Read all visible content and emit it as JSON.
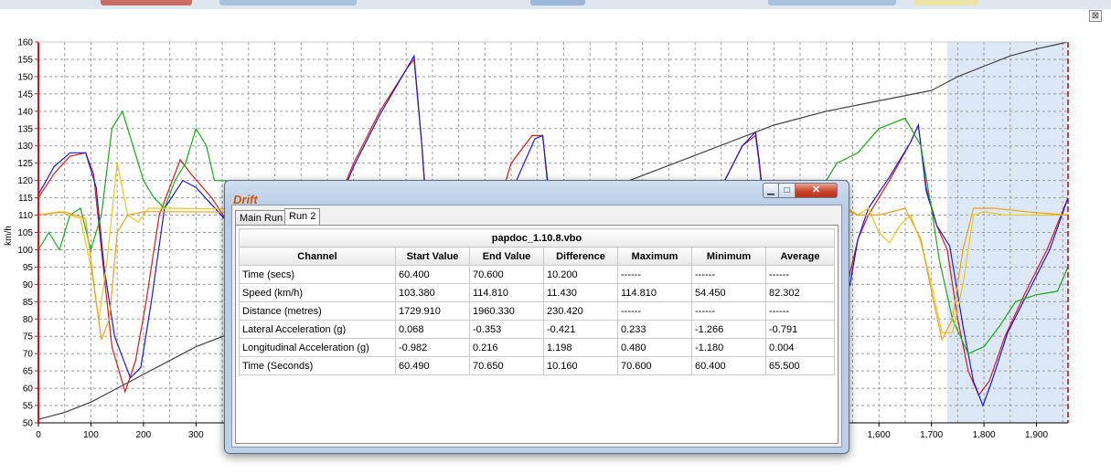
{
  "chart_data": {
    "type": "line",
    "ylabel": "km/h",
    "xlim": [
      0,
      1960
    ],
    "ylim": [
      50,
      160
    ],
    "x_ticks": [
      0,
      100,
      200,
      300,
      1600,
      1700,
      1800,
      1900
    ],
    "x_tick_labels": [
      "0",
      "100",
      "200",
      "300",
      "1,600",
      "1,700",
      "1,800",
      "1,900"
    ],
    "y_ticks": [
      50,
      55,
      60,
      65,
      70,
      75,
      80,
      85,
      90,
      95,
      100,
      105,
      110,
      115,
      120,
      125,
      130,
      135,
      140,
      145,
      150,
      155,
      160
    ],
    "grid": true,
    "highlight_range": [
      1730,
      1960
    ],
    "series": [
      {
        "color": "#d81b1b",
        "points": [
          [
            0,
            115
          ],
          [
            30,
            122
          ],
          [
            60,
            127
          ],
          [
            90,
            128
          ],
          [
            105,
            122
          ],
          [
            120,
            100
          ],
          [
            140,
            72
          ],
          [
            165,
            59
          ],
          [
            185,
            68
          ],
          [
            205,
            85
          ],
          [
            230,
            110
          ],
          [
            270,
            126
          ],
          [
            290,
            122
          ],
          [
            330,
            115
          ],
          [
            360,
            108
          ],
          [
            380,
            98
          ],
          [
            540,
            103
          ],
          [
            600,
            125
          ],
          [
            650,
            140
          ],
          [
            700,
            152
          ],
          [
            715,
            155
          ],
          [
            730,
            130
          ],
          [
            740,
            110
          ],
          [
            880,
            115
          ],
          [
            900,
            125
          ],
          [
            940,
            133
          ],
          [
            960,
            133
          ],
          [
            975,
            110
          ],
          [
            995,
            102
          ],
          [
            1020,
            100
          ],
          [
            1040,
            80
          ],
          [
            1060,
            70
          ],
          [
            1080,
            58
          ],
          [
            1100,
            57
          ],
          [
            1130,
            75
          ],
          [
            1160,
            95
          ],
          [
            1170,
            103
          ],
          [
            1220,
            108
          ],
          [
            1260,
            108
          ],
          [
            1300,
            118
          ],
          [
            1340,
            130
          ],
          [
            1365,
            133
          ],
          [
            1372,
            125
          ],
          [
            1382,
            110
          ],
          [
            1400,
            102
          ],
          [
            1420,
            100
          ],
          [
            1440,
            80
          ],
          [
            1460,
            62
          ],
          [
            1480,
            60
          ],
          [
            1500,
            75
          ],
          [
            1540,
            90
          ],
          [
            1560,
            103
          ],
          [
            1580,
            110
          ],
          [
            1620,
            120
          ],
          [
            1660,
            131
          ],
          [
            1675,
            136
          ],
          [
            1690,
            118
          ],
          [
            1710,
            107
          ],
          [
            1730,
            100
          ],
          [
            1750,
            80
          ],
          [
            1770,
            65
          ],
          [
            1790,
            58
          ],
          [
            1810,
            62
          ],
          [
            1840,
            75
          ],
          [
            1880,
            88
          ],
          [
            1920,
            100
          ],
          [
            1960,
            115
          ]
        ]
      },
      {
        "color": "#1a1ad8",
        "points": [
          [
            0,
            116
          ],
          [
            30,
            124
          ],
          [
            60,
            128
          ],
          [
            90,
            128
          ],
          [
            110,
            118
          ],
          [
            125,
            95
          ],
          [
            145,
            75
          ],
          [
            175,
            63
          ],
          [
            195,
            66
          ],
          [
            215,
            85
          ],
          [
            240,
            112
          ],
          [
            275,
            120
          ],
          [
            300,
            118
          ],
          [
            330,
            113
          ],
          [
            360,
            108
          ],
          [
            380,
            97
          ],
          [
            540,
            102
          ],
          [
            600,
            124
          ],
          [
            650,
            139
          ],
          [
            700,
            152
          ],
          [
            715,
            156
          ],
          [
            730,
            130
          ],
          [
            740,
            108
          ],
          [
            880,
            113
          ],
          [
            910,
            120
          ],
          [
            945,
            132
          ],
          [
            960,
            133
          ],
          [
            975,
            112
          ],
          [
            995,
            103
          ],
          [
            1020,
            101
          ],
          [
            1045,
            82
          ],
          [
            1065,
            72
          ],
          [
            1085,
            60
          ],
          [
            1105,
            57
          ],
          [
            1135,
            75
          ],
          [
            1160,
            94
          ],
          [
            1170,
            104
          ],
          [
            1220,
            108
          ],
          [
            1260,
            108
          ],
          [
            1300,
            118
          ],
          [
            1340,
            130
          ],
          [
            1365,
            134
          ],
          [
            1372,
            126
          ],
          [
            1382,
            111
          ],
          [
            1400,
            104
          ],
          [
            1420,
            101
          ],
          [
            1445,
            82
          ],
          [
            1465,
            64
          ],
          [
            1485,
            60
          ],
          [
            1505,
            75
          ],
          [
            1545,
            90
          ],
          [
            1560,
            103
          ],
          [
            1580,
            112
          ],
          [
            1620,
            121
          ],
          [
            1660,
            131
          ],
          [
            1675,
            136
          ],
          [
            1690,
            117
          ],
          [
            1710,
            107
          ],
          [
            1735,
            101
          ],
          [
            1760,
            78
          ],
          [
            1780,
            62
          ],
          [
            1798,
            55
          ],
          [
            1815,
            62
          ],
          [
            1845,
            76
          ],
          [
            1885,
            88
          ],
          [
            1925,
            100
          ],
          [
            1960,
            115
          ]
        ]
      },
      {
        "color": "#1aa81a",
        "points": [
          [
            0,
            100
          ],
          [
            20,
            105
          ],
          [
            40,
            100
          ],
          [
            60,
            110
          ],
          [
            80,
            112
          ],
          [
            100,
            100
          ],
          [
            120,
            110
          ],
          [
            140,
            135
          ],
          [
            160,
            140
          ],
          [
            180,
            130
          ],
          [
            200,
            120
          ],
          [
            220,
            115
          ],
          [
            240,
            112
          ],
          [
            260,
            120
          ],
          [
            280,
            125
          ],
          [
            300,
            135
          ],
          [
            320,
            130
          ],
          [
            335,
            120
          ],
          [
            1450,
            115
          ],
          [
            1480,
            110
          ],
          [
            1500,
            120
          ],
          [
            1520,
            125
          ],
          [
            1560,
            128
          ],
          [
            1600,
            135
          ],
          [
            1650,
            138
          ],
          [
            1680,
            130
          ],
          [
            1700,
            112
          ],
          [
            1715,
            97
          ],
          [
            1740,
            80
          ],
          [
            1770,
            70
          ],
          [
            1800,
            72
          ],
          [
            1830,
            78
          ],
          [
            1860,
            85
          ],
          [
            1900,
            87
          ],
          [
            1940,
            88
          ],
          [
            1960,
            95
          ]
        ]
      },
      {
        "color": "#e8c81c",
        "points": [
          [
            0,
            110
          ],
          [
            40,
            111
          ],
          [
            60,
            110
          ],
          [
            80,
            109
          ],
          [
            100,
            95
          ],
          [
            115,
            80
          ],
          [
            130,
            96
          ],
          [
            150,
            125
          ],
          [
            170,
            110
          ],
          [
            190,
            108
          ],
          [
            210,
            112
          ],
          [
            240,
            112
          ],
          [
            1450,
            110
          ],
          [
            1480,
            100
          ],
          [
            1500,
            115
          ],
          [
            1520,
            108
          ],
          [
            1540,
            112
          ],
          [
            1560,
            110
          ],
          [
            1580,
            112
          ],
          [
            1600,
            105
          ],
          [
            1620,
            102
          ],
          [
            1640,
            107
          ],
          [
            1660,
            110
          ],
          [
            1680,
            102
          ],
          [
            1700,
            90
          ],
          [
            1720,
            76
          ],
          [
            1740,
            76
          ],
          [
            1760,
            90
          ],
          [
            1780,
            110
          ],
          [
            1800,
            111
          ],
          [
            1840,
            110
          ],
          [
            1900,
            110
          ],
          [
            1960,
            110
          ]
        ]
      },
      {
        "color": "#f0a020",
        "points": [
          [
            0,
            110
          ],
          [
            50,
            111
          ],
          [
            90,
            109
          ],
          [
            110,
            85
          ],
          [
            120,
            74
          ],
          [
            135,
            80
          ],
          [
            150,
            105
          ],
          [
            170,
            110
          ],
          [
            200,
            111
          ],
          [
            240,
            111
          ],
          [
            1450,
            110
          ],
          [
            1470,
            100
          ],
          [
            1490,
            95
          ],
          [
            1510,
            100
          ],
          [
            1530,
            112
          ],
          [
            1560,
            110
          ],
          [
            1600,
            110
          ],
          [
            1650,
            112
          ],
          [
            1680,
            103
          ],
          [
            1700,
            88
          ],
          [
            1720,
            74
          ],
          [
            1740,
            80
          ],
          [
            1760,
            100
          ],
          [
            1780,
            112
          ],
          [
            1820,
            112
          ],
          [
            1880,
            111
          ],
          [
            1960,
            110
          ]
        ]
      },
      {
        "color": "#404040",
        "points": [
          [
            0,
            51
          ],
          [
            50,
            53
          ],
          [
            100,
            56
          ],
          [
            150,
            60
          ],
          [
            200,
            64
          ],
          [
            250,
            68
          ],
          [
            300,
            72
          ],
          [
            1400,
            136
          ],
          [
            1500,
            140
          ],
          [
            1600,
            143
          ],
          [
            1700,
            146
          ],
          [
            1750,
            150
          ],
          [
            1800,
            153
          ],
          [
            1850,
            156
          ],
          [
            1900,
            158
          ],
          [
            1960,
            160
          ]
        ]
      }
    ]
  },
  "dialog": {
    "tabs": [
      "Main Run",
      "Run 2"
    ],
    "filename": "papdoc_1.10.8.vbo",
    "columns": [
      "Channel",
      "Start Value",
      "End Value",
      "Difference",
      "Maximum",
      "Minimum",
      "Average"
    ],
    "rows": [
      [
        "Time (secs)",
        "60.400",
        "70.600",
        "10.200",
        "------",
        "------",
        "------"
      ],
      [
        "Speed (km/h)",
        "103.380",
        "114.810",
        "11.430",
        "114.810",
        "54.450",
        "82.302"
      ],
      [
        "Distance (metres)",
        "1729.910",
        "1960.330",
        "230.420",
        "------",
        "------",
        "------"
      ],
      [
        "Lateral Acceleration (g)",
        "0.068",
        "-0.353",
        "-0.421",
        "0.233",
        "-1.266",
        "-0.791"
      ],
      [
        "Longitudinal Acceleration (g)",
        "-0.982",
        "0.216",
        "1.198",
        "0.480",
        "-1.180",
        "0.004"
      ],
      [
        "Time (Seconds)",
        "60.490",
        "70.650",
        "10.160",
        "70.600",
        "60.400",
        "65.500"
      ]
    ],
    "window_buttons": {
      "minimize": "▁",
      "maximize": "□",
      "close": "✕"
    },
    "icon_text": "Drift"
  },
  "outer_close": "⊠"
}
